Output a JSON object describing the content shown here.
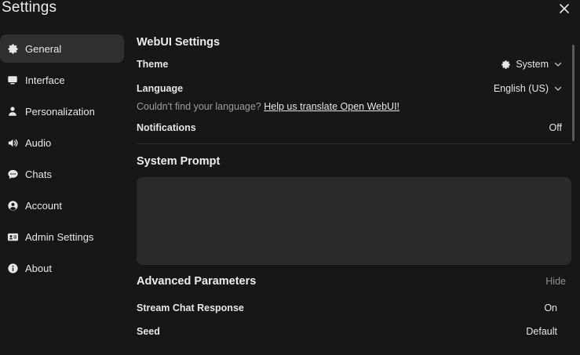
{
  "window": {
    "title": "Settings"
  },
  "sidebar": {
    "items": [
      {
        "label": "General",
        "icon": "gear-icon",
        "active": true
      },
      {
        "label": "Interface",
        "icon": "monitor-icon"
      },
      {
        "label": "Personalization",
        "icon": "user-icon"
      },
      {
        "label": "Audio",
        "icon": "speaker-icon"
      },
      {
        "label": "Chats",
        "icon": "chat-bubble-icon"
      },
      {
        "label": "Account",
        "icon": "account-circle-icon"
      },
      {
        "label": "Admin Settings",
        "icon": "id-card-icon"
      },
      {
        "label": "About",
        "icon": "info-icon"
      }
    ]
  },
  "webui": {
    "section_title": "WebUI Settings",
    "theme_label": "Theme",
    "theme_value": "System",
    "language_label": "Language",
    "language_value": "English (US)",
    "language_hint": "Couldn't find your language?",
    "language_link": "Help us translate Open WebUI!",
    "notifications_label": "Notifications",
    "notifications_value": "Off"
  },
  "system_prompt": {
    "title": "System Prompt",
    "value": ""
  },
  "advanced": {
    "title": "Advanced Parameters",
    "toggle_label": "Hide",
    "stream_label": "Stream Chat Response",
    "stream_value": "On",
    "seed_label": "Seed",
    "seed_value": "Default"
  },
  "colors": {
    "background": "#171717",
    "active_item": "#2f2f2f",
    "prompt_box": "#2a2a2a"
  }
}
